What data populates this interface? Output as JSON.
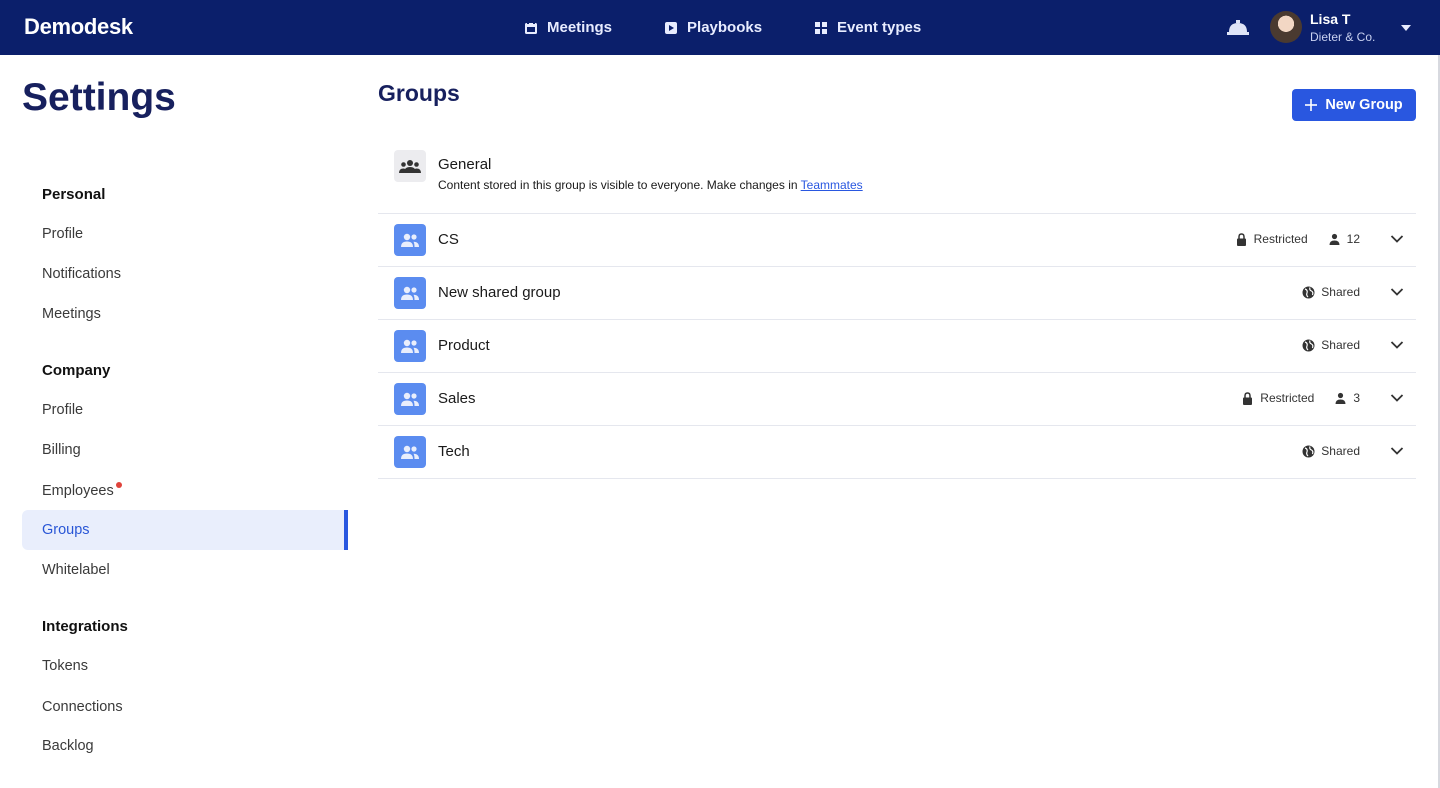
{
  "app": {
    "logo": "Demodesk"
  },
  "nav": {
    "items": [
      {
        "label": "Meetings",
        "icon": "calendar-icon"
      },
      {
        "label": "Playbooks",
        "icon": "play-icon"
      },
      {
        "label": "Event types",
        "icon": "grid-icon"
      }
    ]
  },
  "user": {
    "name": "Lisa T",
    "company": "Dieter & Co."
  },
  "sidebar": {
    "title": "Settings",
    "sections": [
      {
        "title": "Personal",
        "items": [
          "Profile",
          "Notifications",
          "Meetings"
        ]
      },
      {
        "title": "Company",
        "items": [
          "Profile",
          "Billing",
          "Employees",
          "Groups",
          "Whitelabel"
        ]
      },
      {
        "title": "Integrations",
        "items": [
          "Tokens",
          "Connections",
          "Backlog"
        ]
      }
    ],
    "active_item": "Groups",
    "notification_item": "Employees"
  },
  "main": {
    "title": "Groups",
    "new_group_label": "New Group",
    "general": {
      "name": "General",
      "description": "Content stored in this group is visible to everyone. Make changes in",
      "link": "Teammates"
    },
    "groups": [
      {
        "name": "CS",
        "access": "Restricted",
        "member_count": "12"
      },
      {
        "name": "New shared group",
        "access": "Shared",
        "member_count": ""
      },
      {
        "name": "Product",
        "access": "Shared",
        "member_count": ""
      },
      {
        "name": "Sales",
        "access": "Restricted",
        "member_count": "3"
      },
      {
        "name": "Tech",
        "access": "Shared",
        "member_count": ""
      }
    ]
  },
  "colors": {
    "nav_bg": "#0b1f6b",
    "accent": "#2957e0",
    "group_icon": "#5b8cf0",
    "title": "#17205e"
  }
}
